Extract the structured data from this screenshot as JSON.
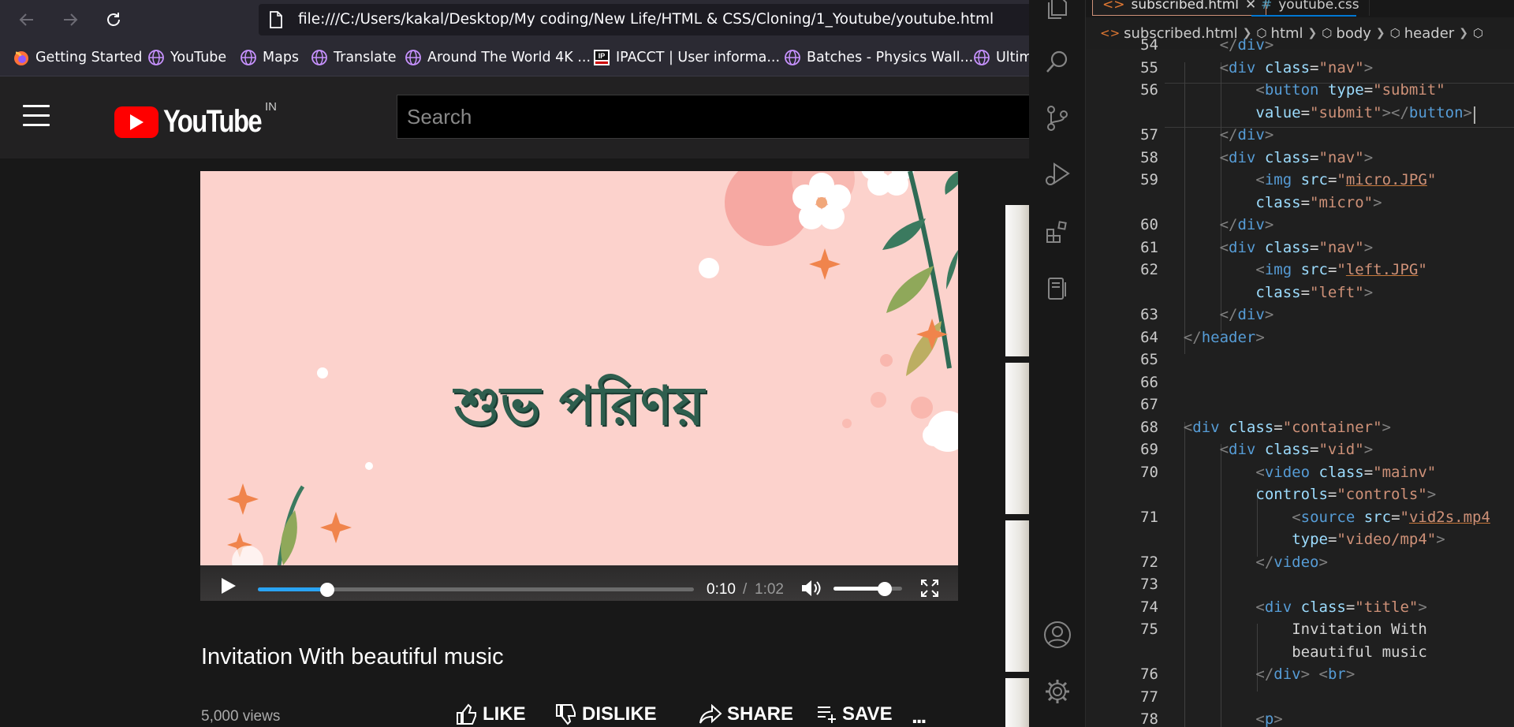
{
  "browser": {
    "url": "file:///C:/Users/kakal/Desktop/My coding/New Life/HTML & CSS/Cloning/1_Youtube/youtube.html",
    "bookmarks": [
      {
        "label": "Getting Started",
        "icon": "firefox-icon"
      },
      {
        "label": "YouTube",
        "icon": "globe-icon"
      },
      {
        "label": "Maps",
        "icon": "globe-icon"
      },
      {
        "label": "Translate",
        "icon": "globe-icon"
      },
      {
        "label": "Around The World 4K ...",
        "icon": "globe-icon"
      },
      {
        "label": "IPACCT | User informa...",
        "icon": "ipacct-icon"
      },
      {
        "label": "Batches - Physics Wall...",
        "icon": "globe-icon"
      },
      {
        "label": "Ultim",
        "icon": "globe-icon"
      }
    ]
  },
  "youtube": {
    "logo_text": "YouTube",
    "region": "IN",
    "search_placeholder": "Search",
    "video": {
      "overlay_text": "শুভ পরিণয়",
      "time_current": "0:10",
      "time_separator": "/",
      "time_total": "1:02",
      "progress_fraction": 0.16,
      "volume_fraction": 0.75,
      "accent_color": "#2aa4f4"
    },
    "title": "Invitation With beautiful music",
    "views": "5,000 views",
    "actions": {
      "like": "LIKE",
      "dislike": "DISLIKE",
      "share": "SHARE",
      "save": "SAVE",
      "more": "..."
    }
  },
  "vscode": {
    "tabs": [
      {
        "label": "subscribed.html",
        "icon": "html-icon"
      },
      {
        "label": "youtube.css",
        "icon": "css-icon"
      }
    ],
    "breadcrumbs": [
      "subscribed.html",
      "html",
      "body",
      "header"
    ],
    "line_numbers": [
      "54",
      "55",
      "56",
      "",
      "57",
      "58",
      "59",
      "",
      "60",
      "61",
      "62",
      "",
      "63",
      "64",
      "65",
      "66",
      "67",
      "68",
      "69",
      "70",
      "",
      "71",
      "",
      "72",
      "73",
      "74",
      "75",
      "",
      "76",
      "77",
      "78"
    ],
    "code": [
      "</div>",
      "<div class=\"nav\">",
      "<button type=\"submit\"",
      "value=\"submit\"></button>",
      "</div>",
      "<div class=\"nav\">",
      "<img src=\"micro.JPG\"",
      "class=\"micro\">",
      "</div>",
      "<div class=\"nav\">",
      "<img src=\"left.JPG\"",
      "class=\"left\">",
      "</div>",
      "</header>",
      "",
      "",
      "",
      "<div class=\"container\">",
      "<div class=\"vid\">",
      "<video class=\"mainv\"",
      "controls=\"controls\">",
      "<source src=\"vid2s.mp4",
      "type=\"video/mp4\">",
      "</video>",
      "",
      "<div class=\"title\">",
      "Invitation With",
      "beautiful music",
      "</div> <br>",
      "",
      "<p>"
    ]
  }
}
